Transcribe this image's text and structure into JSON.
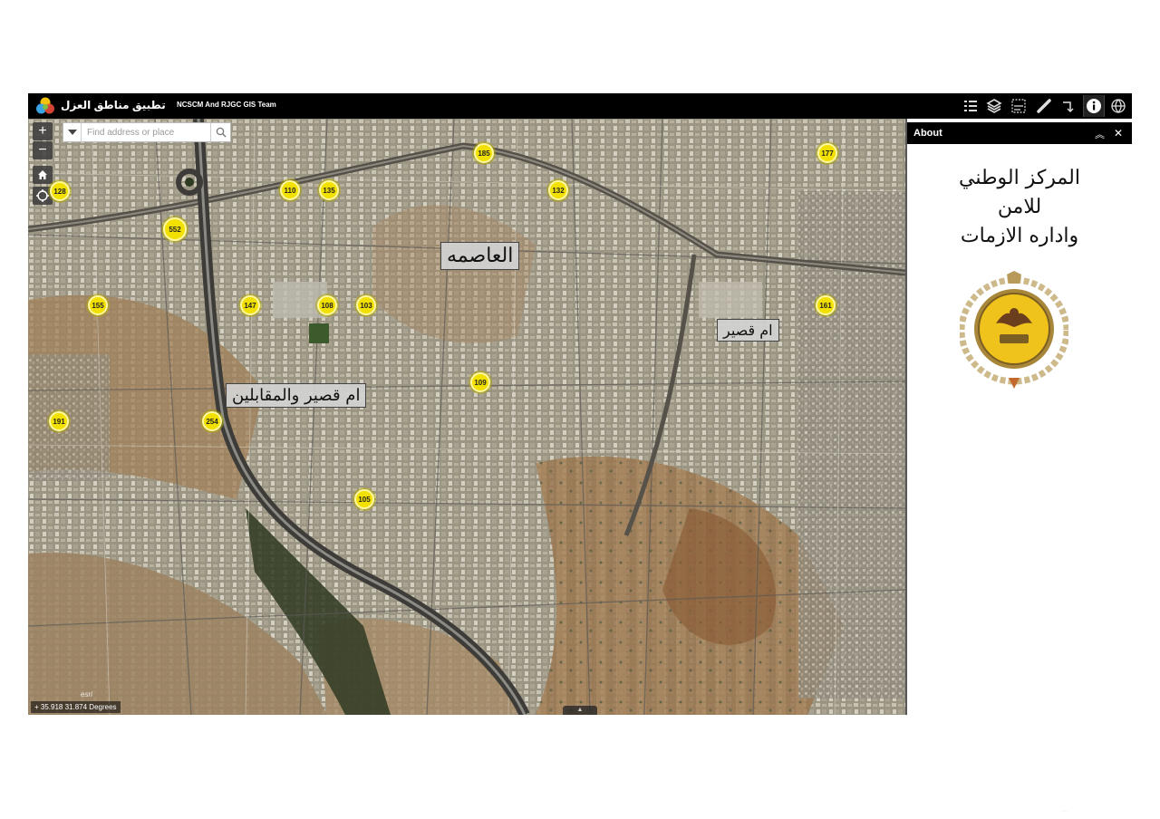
{
  "header": {
    "app_title": "تطبيق مناطق العزل",
    "subtitle": "NCSCM And RJGC GIS Team",
    "buttons": [
      {
        "name": "legend",
        "icon": "legend-list-icon"
      },
      {
        "name": "layers",
        "icon": "layers-icon"
      },
      {
        "name": "attribute-table",
        "icon": "attribute-table-icon"
      },
      {
        "name": "measure",
        "icon": "ruler-icon"
      },
      {
        "name": "directions",
        "icon": "directions-icon"
      },
      {
        "name": "about",
        "icon": "info-icon"
      },
      {
        "name": "basemap",
        "icon": "basemap-gallery-icon"
      }
    ]
  },
  "map": {
    "search": {
      "placeholder": "Find address or place"
    },
    "zoom_in": "+",
    "zoom_out": "−",
    "coordinates": "35.918 31.874 Degrees",
    "attribution": "esri",
    "markers": [
      "185",
      "177",
      "128",
      "110",
      "135",
      "132",
      "552",
      "155",
      "147",
      "108",
      "103",
      "161",
      "109",
      "191",
      "254",
      "105"
    ],
    "labels": {
      "capital": "العاصمه",
      "umm_qusair": "ام قصير",
      "umm_qusair_muqabalain": "ام قصير والمقابلين"
    }
  },
  "about_panel": {
    "title": "About",
    "lines": [
      "المركز الوطني",
      "للامن",
      "واداره الازمات"
    ]
  },
  "colors": {
    "header_bg": "#000000",
    "marker": "#f2e100",
    "panel_bg": "#ffffff",
    "emblem_gold": "#c9a227"
  }
}
